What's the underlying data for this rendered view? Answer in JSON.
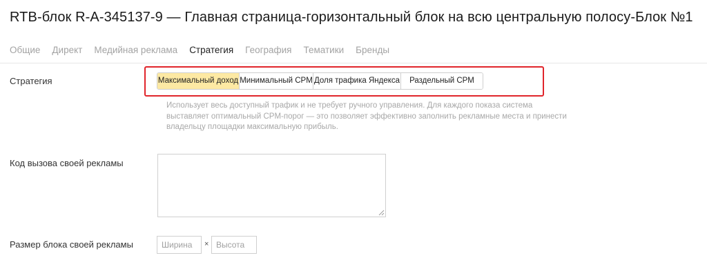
{
  "title": "RTB-блок R-A-345137-9 — Главная страница-горизонтальный блок на всю центральную полосу-Блок №1",
  "tabs": [
    {
      "label": "Общие"
    },
    {
      "label": "Директ"
    },
    {
      "label": "Медийная реклама"
    },
    {
      "label": "Стратегия"
    },
    {
      "label": "География"
    },
    {
      "label": "Тематики"
    },
    {
      "label": "Бренды"
    }
  ],
  "active_tab": "Стратегия",
  "strategy": {
    "label": "Стратегия",
    "options": [
      {
        "label": "Максимальный доход"
      },
      {
        "label": "Минимальный CPM"
      },
      {
        "label": "Доля трафика Яндекса"
      },
      {
        "label": "Раздельный CPM"
      }
    ],
    "selected": "Максимальный доход",
    "hint_lines": [
      "Использует весь доступный трафик и не требует ручного управления. Для каждого показа система",
      "выставляет оптимальный CPM-порог — это позволяет эффективно заполнить рекламные места и принести",
      "владельцу площадки максимальную прибыль."
    ],
    "highlight_color": "#e0242a",
    "selected_color": "#fde9a3"
  },
  "own_ad_code": {
    "label": "Код вызова своей рекламы",
    "value": ""
  },
  "own_ad_size": {
    "label": "Размер блока своей рекламы",
    "width_placeholder": "Ширина",
    "separator": "×",
    "height_placeholder": "Высота"
  }
}
